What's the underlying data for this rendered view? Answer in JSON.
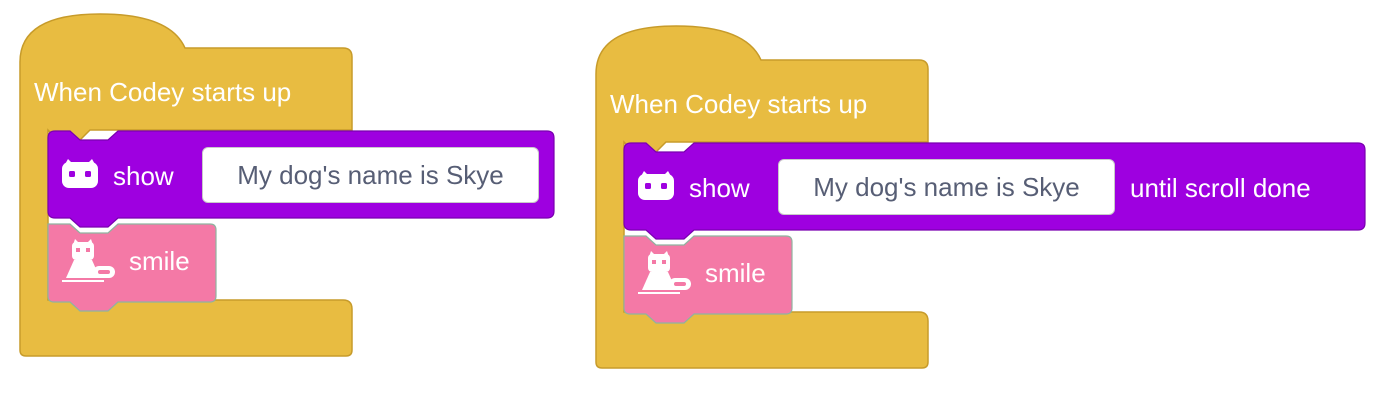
{
  "scripts": [
    {
      "hat_label": "When Codey starts up",
      "show_label": "show",
      "show_text_value": "My dog's name is Skye",
      "show_suffix": "",
      "smile_label": "smile"
    },
    {
      "hat_label": "When Codey starts up",
      "show_label": "show",
      "show_text_value": "My dog's name is Skye",
      "show_suffix": "until scroll done",
      "smile_label": "smile"
    }
  ],
  "colors": {
    "event_block": "#E8BC41",
    "event_border": "#C79B2A",
    "display_block": "#9E00E0",
    "display_border": "#7A00B0",
    "emotion_block": "#F479A6",
    "emotion_border": "#8FB3A0"
  },
  "icons": {
    "display_icon": "codey-face-icon",
    "emotion_icon": "codey-emotion-icon"
  }
}
